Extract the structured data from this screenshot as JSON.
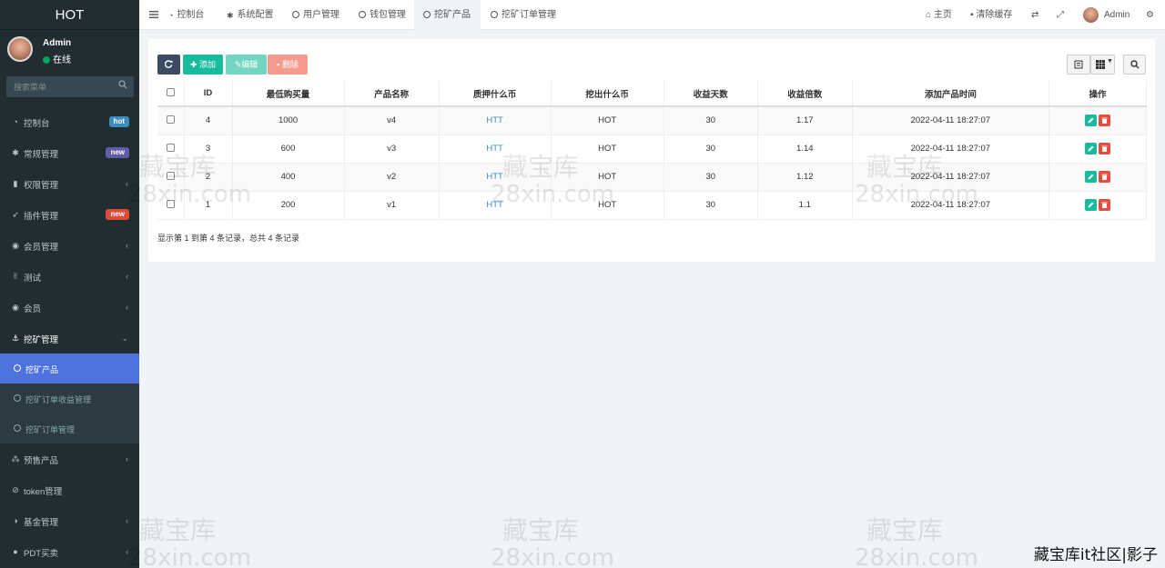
{
  "sidebar": {
    "logo": "HOT",
    "user": {
      "name": "Admin",
      "status": "在线"
    },
    "search_placeholder": "搜索菜单",
    "items": [
      {
        "label": "控制台",
        "icon": "dashboard-icon",
        "badge": "hot",
        "badge_color": "#3c8dbc"
      },
      {
        "label": "常规管理",
        "icon": "cogs-icon",
        "badge": "new",
        "badge_color": "#605ca8"
      },
      {
        "label": "权限管理",
        "icon": "users-icon",
        "chevron": true
      },
      {
        "label": "插件管理",
        "icon": "rocket-icon",
        "badge": "new",
        "badge_color": "#dd4b39"
      },
      {
        "label": "会员管理",
        "icon": "user-circle-icon",
        "chevron": true
      },
      {
        "label": "测试",
        "icon": "hand-icon",
        "chevron": true
      },
      {
        "label": "会员",
        "icon": "user-circle-icon",
        "chevron": true
      },
      {
        "label": "挖矿管理",
        "icon": "anchor-icon",
        "chevron": true,
        "open": true
      }
    ],
    "sub_items": [
      {
        "label": "挖矿产品",
        "active": true
      },
      {
        "label": "挖矿订单收益管理"
      },
      {
        "label": "挖矿订单管理"
      }
    ],
    "items_after": [
      {
        "label": "预售产品",
        "icon": "network-icon",
        "chevron": true
      },
      {
        "label": "token管理",
        "icon": "link-icon"
      },
      {
        "label": "基金管理",
        "icon": "half-circle-icon",
        "chevron": true
      },
      {
        "label": "PDT买卖",
        "icon": "coin-icon",
        "chevron": true
      }
    ]
  },
  "header": {
    "tabs": [
      {
        "label": "控制台",
        "icon": "dashboard-icon"
      },
      {
        "label": "系统配置",
        "icon": "gear-icon"
      },
      {
        "label": "用户管理",
        "icon": "circle-icon"
      },
      {
        "label": "钱包管理",
        "icon": "circle-icon"
      },
      {
        "label": "挖矿产品",
        "icon": "circle-icon",
        "active": true
      },
      {
        "label": "挖矿订单管理",
        "icon": "circle-icon"
      }
    ],
    "right": {
      "home": "主页",
      "clear_cache": "清除缓存",
      "user": "Admin"
    }
  },
  "toolbar": {
    "add": "添加",
    "edit": "编辑",
    "delete": "删除"
  },
  "table": {
    "columns": [
      "ID",
      "最低购买量",
      "产品名称",
      "质押什么币",
      "挖出什么币",
      "收益天数",
      "收益倍数",
      "添加产品时间",
      "操作"
    ],
    "rows": [
      {
        "id": "4",
        "min": "1000",
        "name": "v4",
        "stake": "HTT",
        "mine": "HOT",
        "days": "30",
        "mult": "1.17",
        "time": "2022-04-11 18:27:07"
      },
      {
        "id": "3",
        "min": "600",
        "name": "v3",
        "stake": "HTT",
        "mine": "HOT",
        "days": "30",
        "mult": "1.14",
        "time": "2022-04-11 18:27:07"
      },
      {
        "id": "2",
        "min": "400",
        "name": "v2",
        "stake": "HTT",
        "mine": "HOT",
        "days": "30",
        "mult": "1.12",
        "time": "2022-04-11 18:27:07"
      },
      {
        "id": "1",
        "min": "200",
        "name": "v1",
        "stake": "HTT",
        "mine": "HOT",
        "days": "30",
        "mult": "1.1",
        "time": "2022-04-11 18:27:07"
      }
    ],
    "summary": "显示第 1 到第 4 条记录，总共 4 条记录"
  },
  "watermark": {
    "line1": "藏宝库",
    "line2": "28xin.com"
  },
  "corner_text": "藏宝库it社区|影子"
}
